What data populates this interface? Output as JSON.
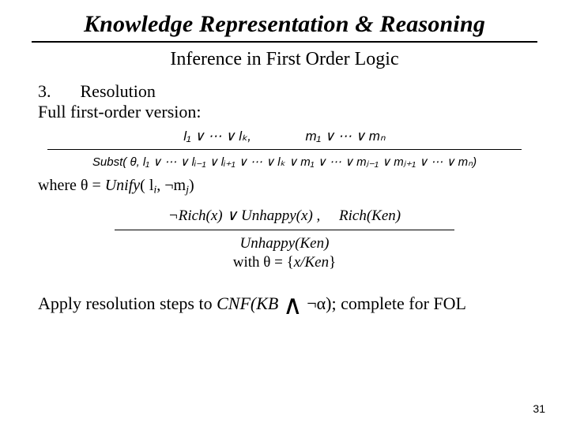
{
  "title": "Knowledge Representation & Reasoning",
  "subtitle": "Inference in First Order Logic",
  "section_number": "3.",
  "section_title": "Resolution",
  "intro": "Full first-order version:",
  "rule": {
    "lhs": "l₁ ∨ ⋯ ∨ lₖ,",
    "rhs": "m₁ ∨ ⋯ ∨ mₙ",
    "result": "Subst( θ, l₁ ∨ ⋯ ∨ lᵢ₋₁ ∨ lᵢ₊₁ ∨ ⋯ ∨ lₖ ∨ m₁ ∨ ⋯ ∨ mⱼ₋₁ ∨ mⱼ₊₁ ∨ ⋯ ∨ mₙ)"
  },
  "where": "where θ = Unify( lᵢ, ¬mⱼ)",
  "example": {
    "lhs": "¬Rich(x) ∨ Unhappy(x) ,",
    "rhs": "Rich(Ken)",
    "result": "Unhappy(Ken)",
    "with": "with θ = {x/Ken}"
  },
  "apply_prefix": "Apply resolution steps to ",
  "apply_cnf": "CNF(KB",
  "apply_wedge": "∧",
  "apply_suffix": "¬α); complete for FOL",
  "page": "31"
}
